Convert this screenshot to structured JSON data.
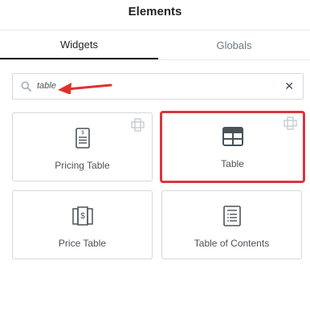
{
  "header": {
    "title": "Elements"
  },
  "tabs": [
    {
      "label": "Widgets",
      "active": true
    },
    {
      "label": "Globals",
      "active": false
    }
  ],
  "search": {
    "value": "table",
    "clear_icon": "close-icon"
  },
  "widgets": [
    {
      "label": "Pricing Table",
      "icon": "pricing-table-icon",
      "pro": true,
      "highlighted": false
    },
    {
      "label": "Table",
      "icon": "table-icon",
      "pro": true,
      "highlighted": true
    },
    {
      "label": "Price Table",
      "icon": "price-table-icon",
      "pro": false,
      "highlighted": false
    },
    {
      "label": "Table of Contents",
      "icon": "table-of-contents-icon",
      "pro": false,
      "highlighted": false
    }
  ],
  "colors": {
    "highlight": "#d9363e",
    "arrow": "#e0312b",
    "pro_badge": "#c9ccd0"
  }
}
